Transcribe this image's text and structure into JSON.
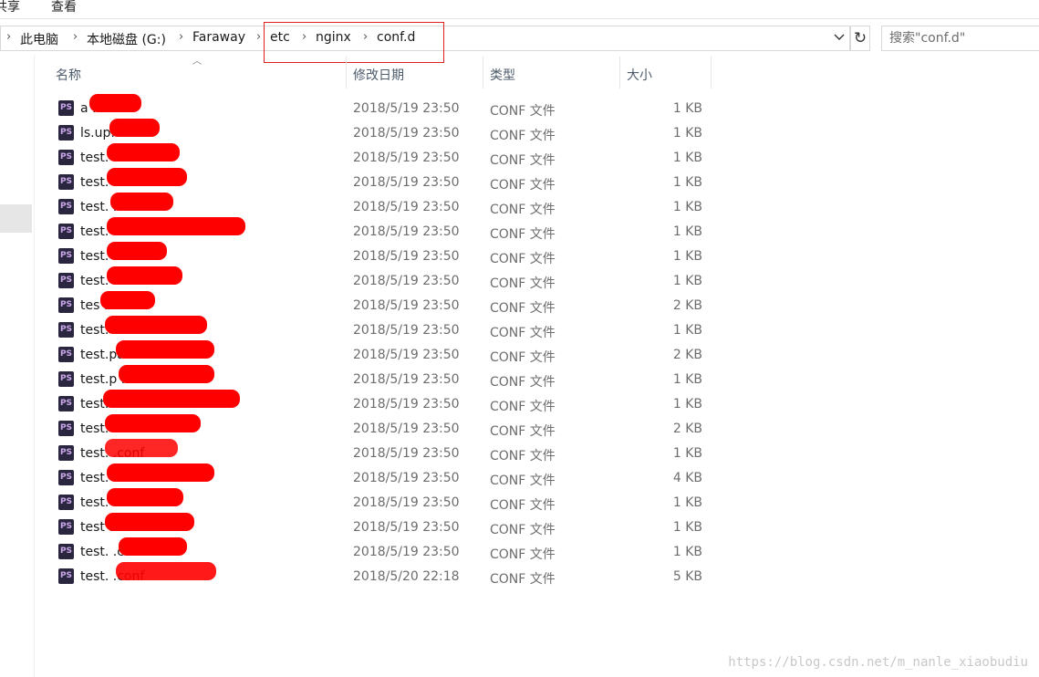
{
  "ribbon": {
    "tabs": [
      "共享",
      "查看"
    ]
  },
  "address_bar": {
    "breadcrumbs": [
      "此电脑",
      "本地磁盘 (G:)",
      "Faraway",
      "etc",
      "nginx",
      "conf.d"
    ]
  },
  "search": {
    "placeholder": "搜索\"conf.d\""
  },
  "icons": {
    "refresh": "refresh-icon",
    "dropdown": "chevron-down-icon",
    "file": "phpstorm-file-icon"
  },
  "columns": {
    "name": "名称",
    "date": "修改日期",
    "type": "类型",
    "size": "大小"
  },
  "files": [
    {
      "name": "a       .conf",
      "date": "2018/5/19 23:50",
      "type": "CONF 文件",
      "size": "1 KB"
    },
    {
      "name": "ls.up.       .conf",
      "date": "2018/5/19 23:50",
      "type": "CONF 文件",
      "size": "1 KB"
    },
    {
      "name": "test.          .conf",
      "date": "2018/5/19 23:50",
      "type": "CONF 文件",
      "size": "1 KB"
    },
    {
      "name": "test.          .conf",
      "date": "2018/5/19 23:50",
      "type": "CONF 文件",
      "size": "1 KB"
    },
    {
      "name": "test.          .conf",
      "date": "2018/5/19 23:50",
      "type": "CONF 文件",
      "size": "1 KB"
    },
    {
      "name": "test.                   .conf",
      "date": "2018/5/19 23:50",
      "type": "CONF 文件",
      "size": "1 KB"
    },
    {
      "name": "test.          .conf",
      "date": "2018/5/19 23:50",
      "type": "CONF 文件",
      "size": "1 KB"
    },
    {
      "name": "test.          .conf",
      "date": "2018/5/19 23:50",
      "type": "CONF 文件",
      "size": "1 KB"
    },
    {
      "name": "tes         .conf",
      "date": "2018/5/19 23:50",
      "type": "CONF 文件",
      "size": "2 KB"
    },
    {
      "name": "test.            .conf",
      "date": "2018/5/19 23:50",
      "type": "CONF 文件",
      "size": "1 KB"
    },
    {
      "name": "test.pa            .conf",
      "date": "2018/5/19 23:50",
      "type": "CONF 文件",
      "size": "2 KB"
    },
    {
      "name": "test.p            .conf",
      "date": "2018/5/19 23:50",
      "type": "CONF 文件",
      "size": "1 KB"
    },
    {
      "name": "test.             .conf",
      "date": "2018/5/19 23:50",
      "type": "CONF 文件",
      "size": "1 KB"
    },
    {
      "name": "test.            .conf",
      "date": "2018/5/19 23:50",
      "type": "CONF 文件",
      "size": "2 KB"
    },
    {
      "name": "test.         .conf",
      "date": "2018/5/19 23:50",
      "type": "CONF 文件",
      "size": "1 KB"
    },
    {
      "name": "test.            .conf",
      "date": "2018/5/19 23:50",
      "type": "CONF 文件",
      "size": "4 KB"
    },
    {
      "name": "test.          .conf",
      "date": "2018/5/19 23:50",
      "type": "CONF 文件",
      "size": "1 KB"
    },
    {
      "name": "test            .conf",
      "date": "2018/5/19 23:50",
      "type": "CONF 文件",
      "size": "1 KB"
    },
    {
      "name": "test.          .conf",
      "date": "2018/5/19 23:50",
      "type": "CONF 文件",
      "size": "1 KB"
    },
    {
      "name": "test.             .conf",
      "date": "2018/5/20 22:18",
      "type": "CONF 文件",
      "size": "5 KB"
    }
  ],
  "watermark": "https://blog.csdn.net/m_nanle_xiaobudiu",
  "colors": {
    "highlight": "#e02020",
    "redaction": "#ff0000",
    "header_text": "#4d5b6b"
  }
}
